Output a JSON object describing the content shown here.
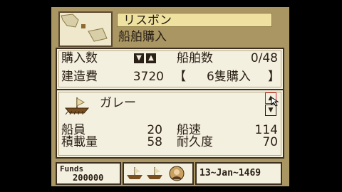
{
  "header": {
    "port_name": "リスボン",
    "menu_title": "船舶購入"
  },
  "purchase": {
    "qty_label": "購入数",
    "ships_label": "船舶数",
    "ships_value": "0/48",
    "cost_label": "建造費",
    "cost_value": "3720",
    "buy_left": "【",
    "buy_text": "6隻購入",
    "buy_right": "】"
  },
  "ship": {
    "name": "ガレー",
    "crew_label": "船員",
    "crew_value": "20",
    "speed_label": "船速",
    "speed_value": "114",
    "cargo_label": "積載量",
    "cargo_value": "58",
    "durability_label": "耐久度",
    "durability_value": "70"
  },
  "status": {
    "funds_label": "Funds",
    "funds_value": "200000",
    "date": "13~Jan~1469"
  },
  "colors": {
    "frame": "#a99663",
    "panel": "#f4f0e0",
    "title_bg": "#efe2a0",
    "text": "#2a2015"
  }
}
